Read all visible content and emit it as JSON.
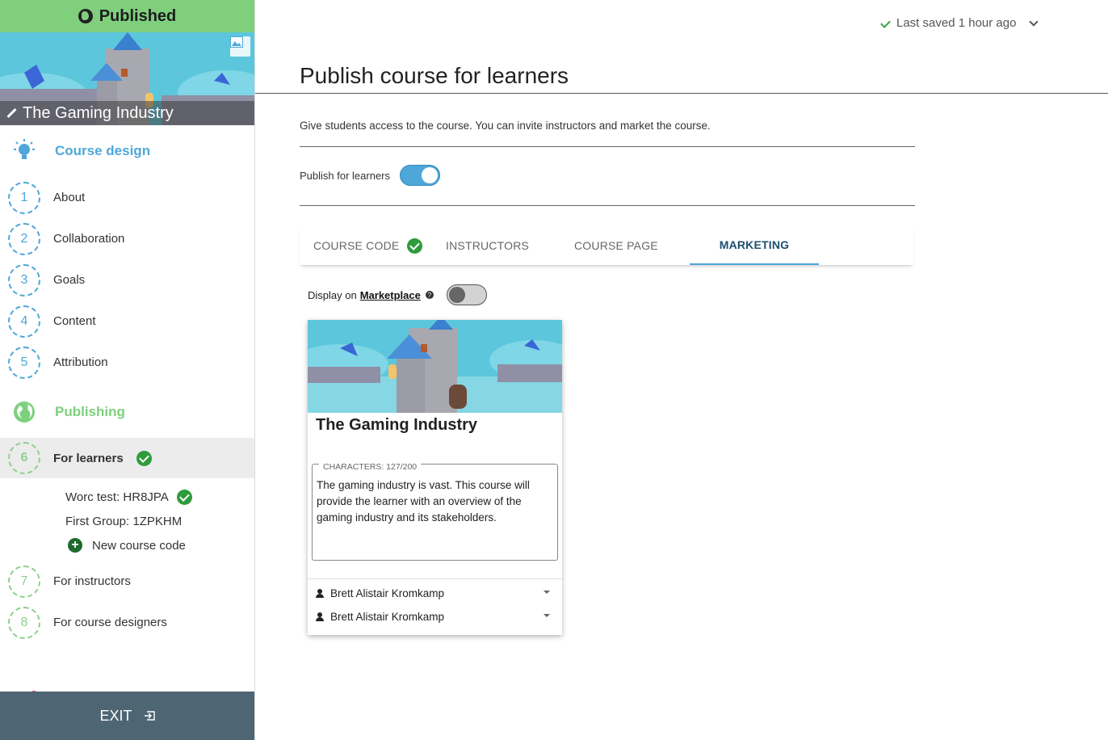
{
  "sidebar": {
    "status": "Published",
    "course_title": "The Gaming Industry",
    "design_section": "Course design",
    "design_items": [
      {
        "num": "1",
        "label": "About"
      },
      {
        "num": "2",
        "label": "Collaboration"
      },
      {
        "num": "3",
        "label": "Goals"
      },
      {
        "num": "4",
        "label": "Content"
      },
      {
        "num": "5",
        "label": "Attribution"
      }
    ],
    "publishing_section": "Publishing",
    "publishing_items": [
      {
        "num": "6",
        "label": "For learners"
      },
      {
        "num": "7",
        "label": "For instructors"
      },
      {
        "num": "8",
        "label": "For course designers"
      }
    ],
    "course_codes": [
      "Worc test: HR8JPA",
      "First Group: 1ZPKHM"
    ],
    "new_code_label": "New course code",
    "exit_label": "EXIT"
  },
  "header": {
    "saved_status": "Last saved 1 hour ago"
  },
  "main": {
    "title": "Publish course for learners",
    "intro": "Give students access to the course. You can invite instructors and market the course.",
    "publish_toggle_label": "Publish for learners",
    "publish_toggle_on": true,
    "tabs": [
      {
        "label": "COURSE CODE"
      },
      {
        "label": "INSTRUCTORS"
      },
      {
        "label": "COURSE PAGE"
      },
      {
        "label": "MARKETING"
      }
    ],
    "active_tab": "MARKETING",
    "marketplace": {
      "prefix": "Display on",
      "link": "Marketplace",
      "enabled": false
    },
    "card": {
      "title": "The Gaming Industry",
      "char_count_label": "CHARACTERS: 127/200",
      "description": "The gaming industry is vast. This course will provide the learner with an overview of the gaming industry and its stakeholders.",
      "authors": [
        "Brett Alistair Kromkamp",
        "Brett Alistair Kromkamp"
      ]
    }
  },
  "colors": {
    "published_green": "#7fcf7d",
    "accent_blue": "#4ea7d8",
    "check_green": "#2e9b3c",
    "exit_bar": "#4e6573"
  }
}
